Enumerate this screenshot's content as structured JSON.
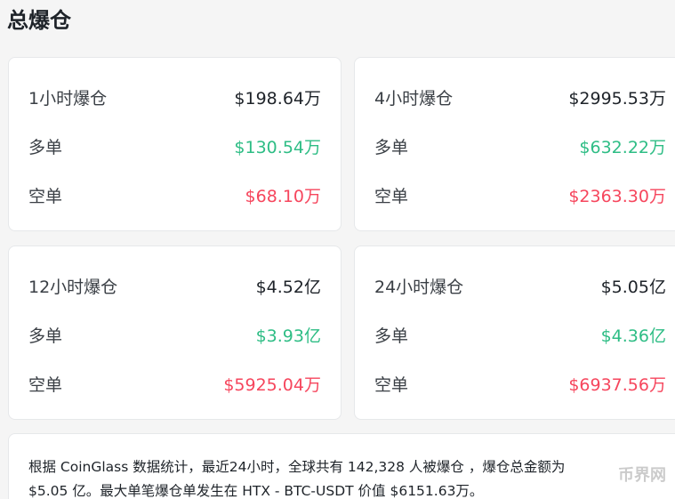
{
  "title": "总爆仓",
  "cards": [
    {
      "label": "1小时爆仓",
      "total": "$198.64万",
      "long_label": "多单",
      "long_value": "$130.54万",
      "short_label": "空单",
      "short_value": "$68.10万"
    },
    {
      "label": "4小时爆仓",
      "total": "$2995.53万",
      "long_label": "多单",
      "long_value": "$632.22万",
      "short_label": "空单",
      "short_value": "$2363.30万"
    },
    {
      "label": "12小时爆仓",
      "total": "$4.52亿",
      "long_label": "多单",
      "long_value": "$3.93亿",
      "short_label": "空单",
      "short_value": "$5925.04万"
    },
    {
      "label": "24小时爆仓",
      "total": "$5.05亿",
      "long_label": "多单",
      "long_value": "$4.36亿",
      "short_label": "空单",
      "short_value": "$6937.56万"
    }
  ],
  "summary": {
    "line1": "根据 CoinGlass 数据统计，最近24小时，全球共有 142,328 人被爆仓 ，爆仓总金额为",
    "line2": "$5.05 亿。最大单笔爆仓单发生在 HTX - BTC-USDT 价值 $6151.63万。"
  },
  "watermark": "币界网",
  "colors": {
    "long": "#2ebd85",
    "short": "#f6465d",
    "text": "#1e2329"
  }
}
